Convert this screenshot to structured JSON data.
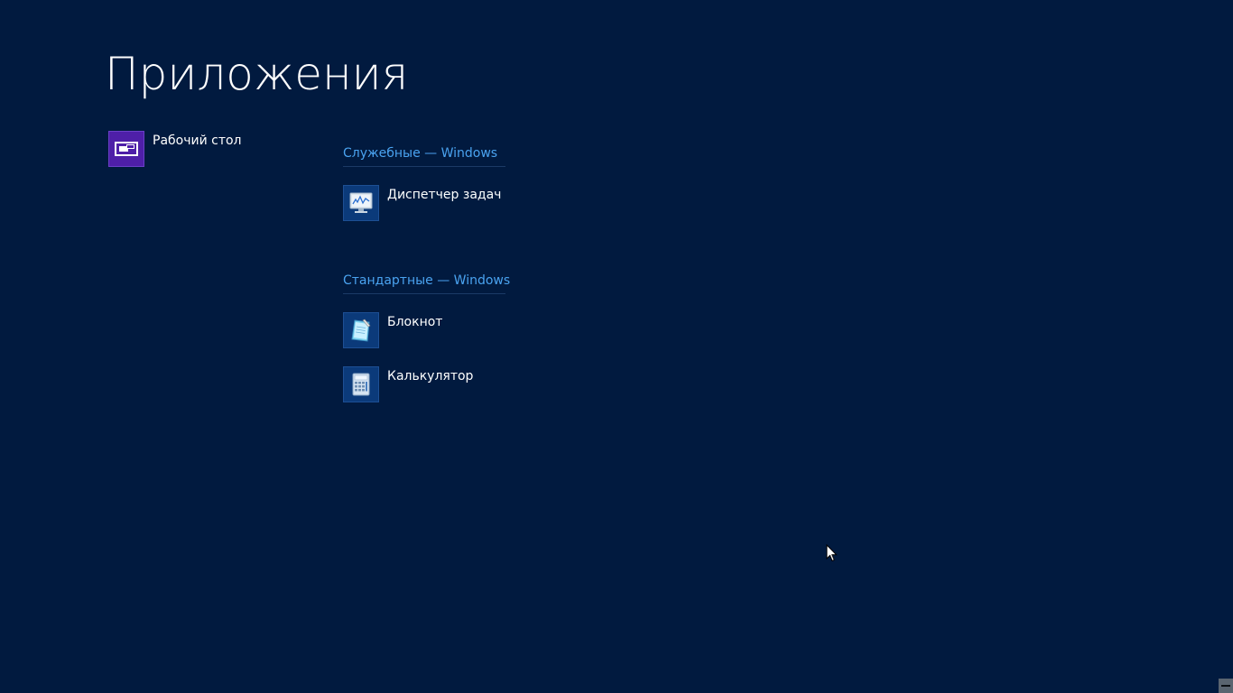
{
  "page": {
    "title": "Приложения"
  },
  "apps": {
    "desktop": {
      "label": "Рабочий стол",
      "icon": "desktop-icon"
    }
  },
  "groups": [
    {
      "header": "Служебные — Windows",
      "items": [
        {
          "label": "Диспетчер задач",
          "icon": "task-manager-icon"
        }
      ]
    },
    {
      "header": "Стандартные — Windows",
      "items": [
        {
          "label": "Блокнот",
          "icon": "notepad-icon"
        },
        {
          "label": "Калькулятор",
          "icon": "calculator-icon"
        }
      ]
    }
  ],
  "colors": {
    "background": "#011a3f",
    "group_header": "#4aa3f0",
    "desktop_tile": "#4e1fa8",
    "app_tile": "#0b3a7a"
  },
  "semantic_zoom": {
    "icon": "zoom-out-icon"
  }
}
